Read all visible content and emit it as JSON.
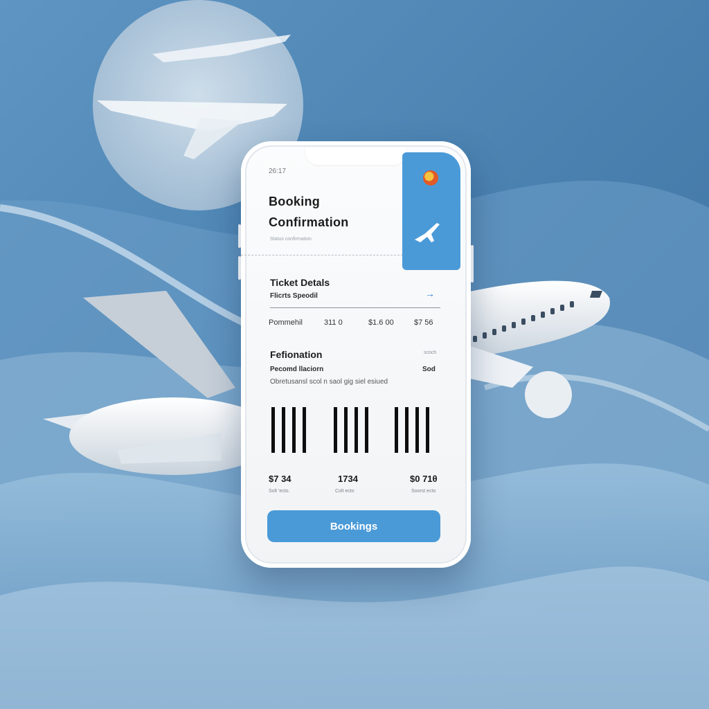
{
  "colors": {
    "accent": "#4a9ad8",
    "background": "#4f86b3",
    "card": "#f7f8f9"
  },
  "status": {
    "time": "26:17"
  },
  "header": {
    "title_line1": "Booking",
    "title_line2": "Confirmation",
    "subtitle": "Status confirmation"
  },
  "tab": {
    "badge_icon": "logo-badge-icon",
    "plane_icon": "airplane-icon"
  },
  "ticket": {
    "title": "Ticket Detals",
    "subtitle": "Flicrts Speodil",
    "row": {
      "label": "Pommehil",
      "v1": "311 0",
      "v2": "$1.6 00",
      "v3": "$7 56"
    }
  },
  "destination": {
    "title": "Fefionation",
    "subtitle": "Pecomd llaciorn",
    "right_top": "scoch",
    "right_label": "Sod",
    "desc": "Obretusansl scol n saol gig siel esiued"
  },
  "summary": [
    {
      "value": "$7 34",
      "caption": "Solt 'ecto."
    },
    {
      "value": "1734",
      "caption": "Colt ecto"
    },
    {
      "value": "$0 71θ",
      "caption": "Soorst ecto"
    }
  ],
  "button": {
    "label": "Bookings"
  }
}
